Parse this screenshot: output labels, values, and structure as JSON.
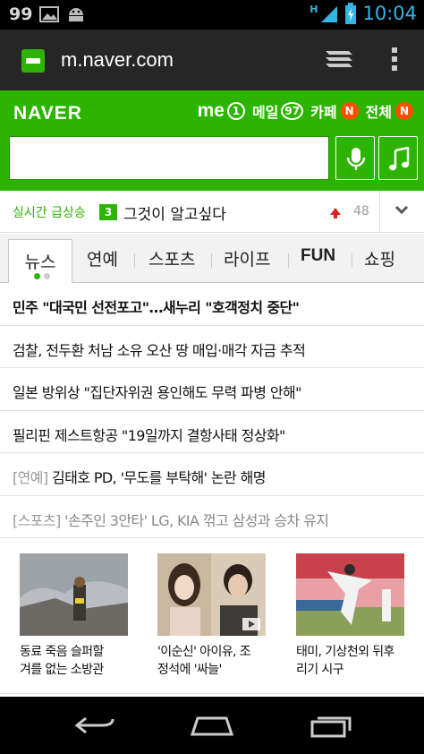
{
  "status_bar": {
    "badge": "99",
    "time": "10:04",
    "network": "H",
    "colors": {
      "time": "#33b5e5"
    },
    "icons": [
      "image-notification-icon",
      "android-notification-icon",
      "signal-icon",
      "battery-charging-icon"
    ]
  },
  "browser": {
    "url": "m.naver.com",
    "icons": [
      "naver-favicon-icon",
      "tabs-icon",
      "overflow-menu-icon"
    ]
  },
  "naver": {
    "logo": "NAVER",
    "me_label": "me",
    "me_count": "1",
    "mail_label": "메일",
    "mail_count": "97",
    "cafe_label": "카페",
    "cafe_badge": "N",
    "all_label": "전체",
    "all_badge": "N",
    "search": {
      "value": "",
      "placeholder": ""
    },
    "colors": {
      "brand": "#2db400",
      "badge": "#ff4e00"
    },
    "icons": [
      "microphone-icon",
      "music-note-icon"
    ]
  },
  "realtime": {
    "label": "실시간 급상승",
    "rank": "3",
    "keyword": "그것이 알고싶다",
    "count": "48",
    "icons": [
      "trend-up-arrow-icon",
      "chevron-down-icon"
    ]
  },
  "tabs": [
    {
      "label": "뉴스",
      "active": true
    },
    {
      "label": "연예"
    },
    {
      "label": "스포츠"
    },
    {
      "label": "라이프"
    },
    {
      "label": "FUN"
    },
    {
      "label": "쇼핑"
    }
  ],
  "news": [
    {
      "title": "민주 \"대국민 선전포고\"…새누리 \"호객정치 중단\""
    },
    {
      "title": "검찰, 전두환 처남 소유 오산 땅 매입·매각 자금 추적"
    },
    {
      "title": "일본 방위상 \"집단자위권 용인해도 무력 파병 안해\""
    },
    {
      "title": "필리핀 제스트항공 \"19일까지 결항사태 정상화\""
    },
    {
      "category": "[연예]",
      "title": "김태호 PD, '무도를 부탁해' 논란 해명"
    },
    {
      "category": "[스포츠]",
      "title": "'손주인 3안타' LG, KIA 꺾고 삼성과 승차 유지"
    }
  ],
  "photos": [
    {
      "caption_line1": "동료 죽음 슬퍼할",
      "caption_line2": "겨를 없는 소방관"
    },
    {
      "caption_line1": "'이순신' 아이유, 조",
      "caption_line2": "정석에 '싸늘'"
    },
    {
      "caption_line1": "태미, 기상천외 뒤후",
      "caption_line2": "리기 시구"
    }
  ],
  "nav_icons": [
    "back-icon",
    "home-icon",
    "recent-apps-icon"
  ]
}
